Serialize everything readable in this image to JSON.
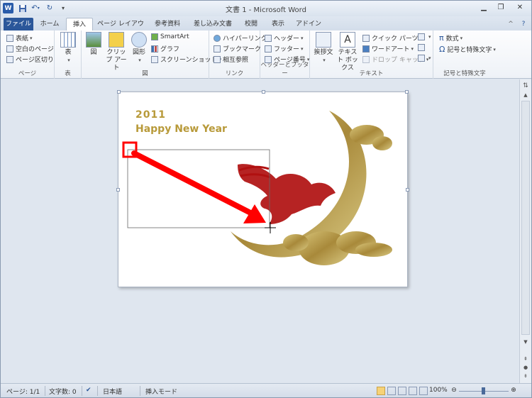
{
  "window": {
    "title": "文書 1 - Microsoft Word",
    "word_icon": "W"
  },
  "quick_access": [
    "save-icon",
    "undo-icon",
    "redo-icon",
    "customize-icon"
  ],
  "tabs": [
    {
      "label": "ファイル"
    },
    {
      "label": "ホーム"
    },
    {
      "label": "挿入"
    },
    {
      "label": "ページ レイアウト"
    },
    {
      "label": "参考資料"
    },
    {
      "label": "差し込み文書"
    },
    {
      "label": "校閲"
    },
    {
      "label": "表示"
    },
    {
      "label": "アドイン"
    }
  ],
  "ribbon": {
    "page": {
      "label": "ページ",
      "items": [
        "表紙",
        "空白のページ",
        "ページ区切り"
      ]
    },
    "table": {
      "label": "表",
      "button": "表"
    },
    "illustrations": {
      "label": "図",
      "picture": "図",
      "clipart": "クリップ アート",
      "shapes": "図形",
      "smartart": "SmartArt",
      "chart": "グラフ",
      "screenshot": "スクリーンショット"
    },
    "links": {
      "label": "リンク",
      "items": [
        "ハイパーリンク",
        "ブックマーク",
        "相互参照"
      ]
    },
    "header_footer": {
      "label": "ヘッダーとフッター",
      "items": [
        "ヘッダー",
        "フッター",
        "ページ番号"
      ]
    },
    "text": {
      "label": "テキスト",
      "greeting": "挨拶文",
      "textbox": "テキスト ボックス",
      "quickparts": "クイック パーツ",
      "wordart": "ワードアート",
      "dropcap": "ドロップ キャップ"
    },
    "symbols": {
      "label": "記号と特殊文字",
      "equation": "数式",
      "symbol": "記号と特殊文字"
    }
  },
  "document": {
    "year": "2011",
    "greeting": "Happy New Year",
    "colors": {
      "gold": "#b89a3a",
      "red": "#b01010",
      "arrow": "#ff0000"
    }
  },
  "status": {
    "page": "ページ: 1/1",
    "chars": "文字数: 0",
    "language": "日本語",
    "mode": "挿入モード",
    "zoom": "100%"
  }
}
